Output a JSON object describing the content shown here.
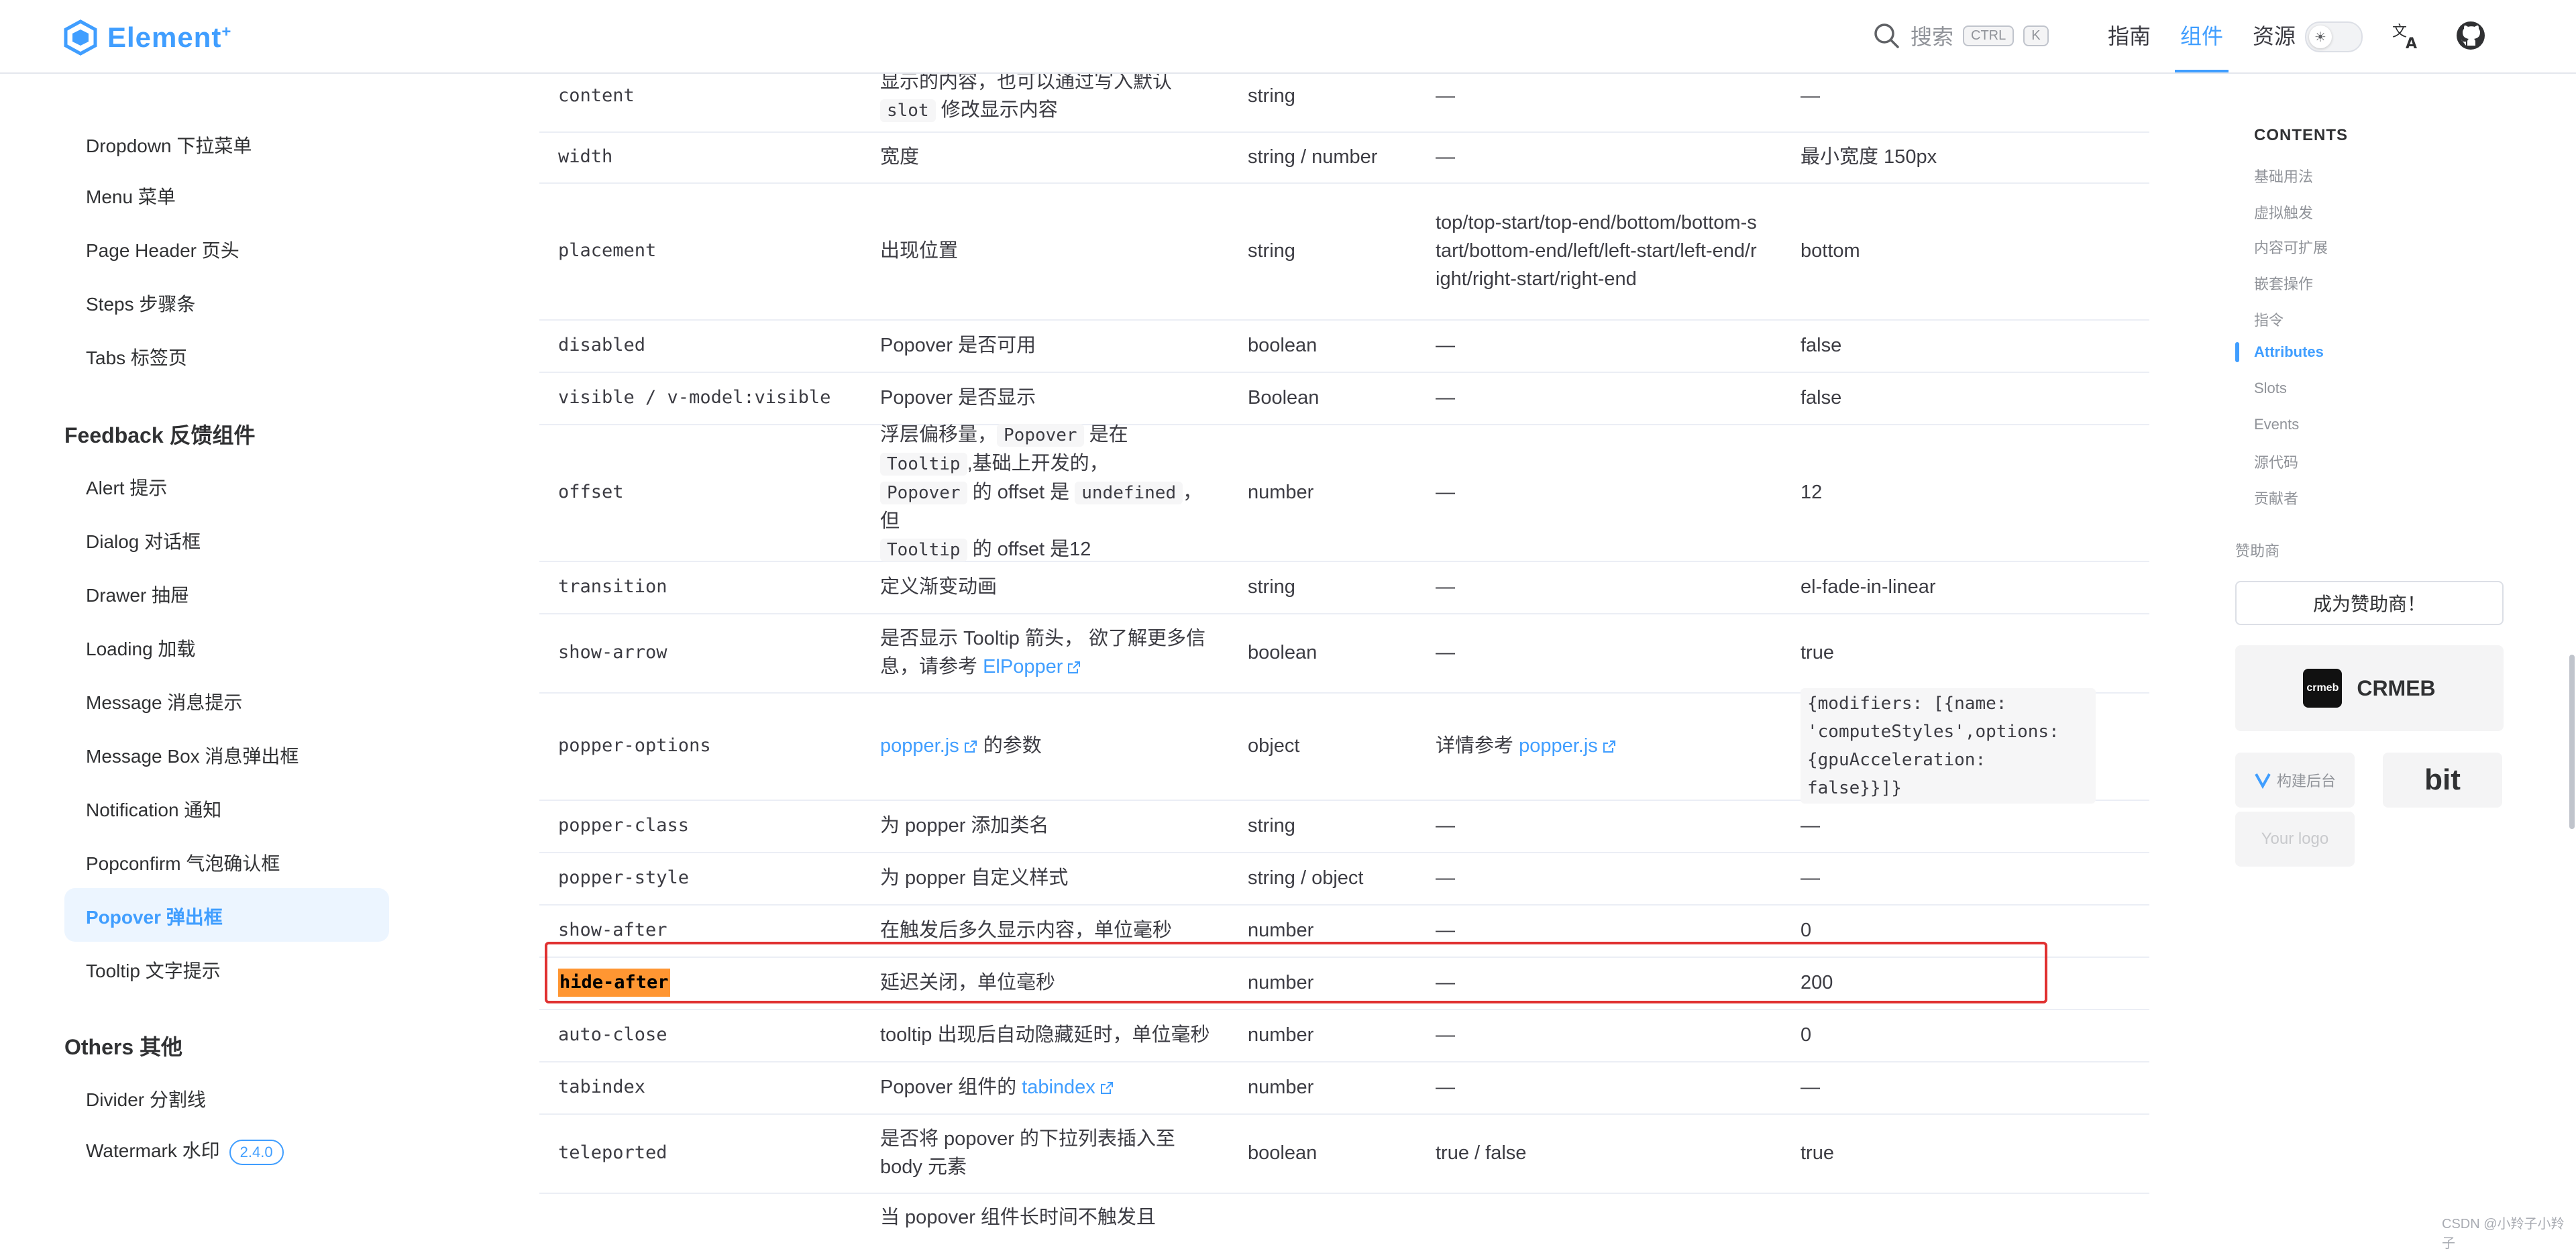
{
  "navbar": {
    "logo_text": "Element",
    "logo_plus": "+",
    "search_placeholder": "搜索",
    "kbd_ctrl": "CTRL",
    "kbd_k": "K",
    "links": [
      "指南",
      "组件",
      "资源"
    ],
    "active_link": "组件",
    "accent": "#409eff"
  },
  "sidebar": {
    "top_items": [
      "Dropdown 下拉菜单",
      "Menu 菜单",
      "Page Header 页头",
      "Steps 步骤条",
      "Tabs 标签页"
    ],
    "group_feedback": "Feedback 反馈组件",
    "feedback_items": [
      "Alert 提示",
      "Dialog 对话框",
      "Drawer 抽屉",
      "Loading 加载",
      "Message 消息提示",
      "Message Box 消息弹出框",
      "Notification 通知",
      "Popconfirm 气泡确认框",
      "Popover 弹出框",
      "Tooltip 文字提示"
    ],
    "active_item": "Popover 弹出框",
    "group_others": "Others 其他",
    "others_items": [
      "Divider 分割线",
      "Watermark 水印"
    ],
    "watermark_version": "2.4.0"
  },
  "table": {
    "rows": {
      "content": {
        "name": "content",
        "desc_a": "显示的内容，也可以通过写入默认",
        "desc_code": "slot",
        "desc_b": "修改显示内容",
        "type": "string",
        "accepted": "—",
        "default": "—"
      },
      "width": {
        "name": "width",
        "desc": "宽度",
        "type": "string / number",
        "accepted": "—",
        "default": "最小宽度 150px"
      },
      "placement": {
        "name": "placement",
        "desc": "出现位置",
        "type": "string",
        "accepted": "top/top-start/top-end/bottom/bottom-start/bottom-end/left/left-start/left-end/right/right-start/right-end",
        "default": "bottom"
      },
      "disabled": {
        "name": "disabled",
        "desc": "Popover 是否可用",
        "type": "boolean",
        "accepted": "—",
        "default": "false"
      },
      "visible": {
        "name": "visible / v-model:visible",
        "desc": "Popover 是否显示",
        "type": "Boolean",
        "accepted": "—",
        "default": "false"
      },
      "offset": {
        "name": "offset",
        "desc_1": "浮层偏移量，",
        "code_1": "Popover",
        "desc_2": "是在",
        "code_2": "Tooltip",
        "desc_3": ",基础上开发的，",
        "code_3": "Popover",
        "desc_4": "的 offset 是",
        "code_4": "undefined",
        "desc_5": "，但",
        "code_5": "Tooltip",
        "desc_6": "的 offset 是12",
        "type": "number",
        "accepted": "—",
        "default": "12"
      },
      "transition": {
        "name": "transition",
        "desc": "定义渐变动画",
        "type": "string",
        "accepted": "—",
        "default": "el-fade-in-linear"
      },
      "show_arrow": {
        "name": "show-arrow",
        "desc": "是否显示 Tooltip 箭头， 欲了解更多信息，请参考",
        "link": "ElPopper",
        "type": "boolean",
        "accepted": "—",
        "default": "true"
      },
      "popper_options": {
        "name": "popper-options",
        "link": "popper.js",
        "desc": "的参数",
        "type": "object",
        "accepted_text": "详情参考",
        "accepted_link": "popper.js",
        "default": "{modifiers: [{name: 'computeStyles',options: {gpuAcceleration: false}}]}"
      },
      "popper_class": {
        "name": "popper-class",
        "desc": "为 popper 添加类名",
        "type": "string",
        "accepted": "—",
        "default": "—"
      },
      "popper_style": {
        "name": "popper-style",
        "desc": "为 popper 自定义样式",
        "type": "string / object",
        "accepted": "—",
        "default": "—"
      },
      "show_after": {
        "name": "show-after",
        "desc": "在触发后多久显示内容，单位毫秒",
        "type": "number",
        "accepted": "—",
        "default": "0"
      },
      "hide_after": {
        "name": "hide-after",
        "desc": "延迟关闭，单位毫秒",
        "type": "number",
        "accepted": "—",
        "default": "200"
      },
      "auto_close": {
        "name": "auto-close",
        "desc": "tooltip 出现后自动隐藏延时，单位毫秒",
        "type": "number",
        "accepted": "—",
        "default": "0"
      },
      "tabindex": {
        "name": "tabindex",
        "desc": "Popover 组件的",
        "link": "tabindex",
        "type": "number",
        "accepted": "—",
        "default": "—"
      },
      "teleported": {
        "name": "teleported",
        "desc": "是否将 popover 的下拉列表插入至 body 元素",
        "type": "boolean",
        "accepted": "true / false",
        "default": "true"
      },
      "partial": {
        "desc": "当 popover 组件长时间不触发且"
      }
    },
    "highlight_color": "#ff9632",
    "selection_box_color": "#e03131"
  },
  "toc": {
    "title": "CONTENTS",
    "items": [
      "基础用法",
      "虚拟触发",
      "内容可扩展",
      "嵌套操作",
      "指令",
      "Attributes",
      "Slots",
      "Events",
      "源代码",
      "贡献者"
    ],
    "active": "Attributes",
    "sponsors_label": "赞助商",
    "become_sponsor": "成为赞助商！",
    "crmeb": "CRMEB",
    "crmeb_logo": "crmeb",
    "vform": "构建后台",
    "bit": "bit",
    "your_logo": "Your logo"
  },
  "watermark": "CSDN @小羚子小羚子"
}
